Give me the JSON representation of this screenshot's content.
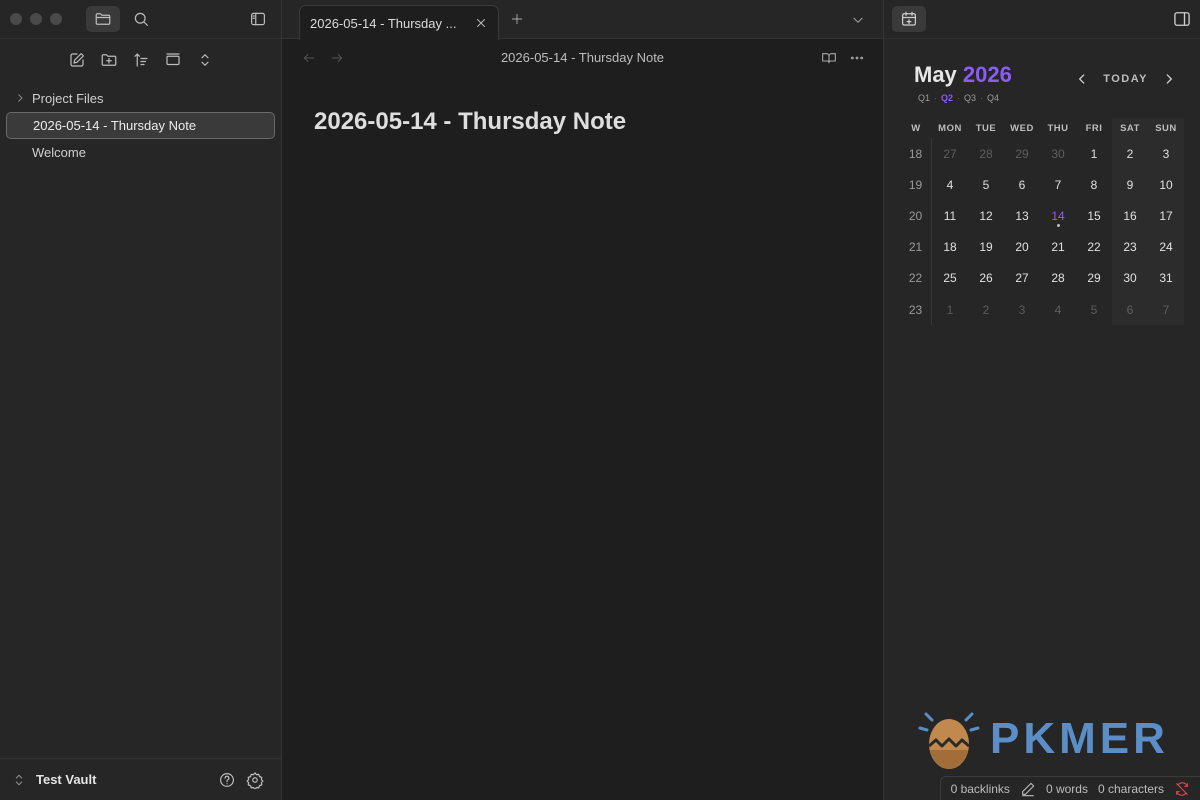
{
  "sidebar": {
    "tree": [
      {
        "label": "Project Files",
        "type": "folder"
      },
      {
        "label": "2026-05-14 - Thursday Note",
        "type": "file",
        "selected": true
      },
      {
        "label": "Welcome",
        "type": "file"
      }
    ],
    "vault_name": "Test Vault",
    "icons": [
      "folder-icon",
      "search-icon",
      "sidebar-toggle-icon",
      "new-note-icon",
      "new-folder-icon",
      "sort-icon",
      "collapse-icon",
      "expand-icon",
      "help-icon",
      "settings-icon"
    ]
  },
  "editor": {
    "tab_title": "2026-05-14 - Thursday ...",
    "view_title": "2026-05-14 - Thursday Note",
    "note_title": "2026-05-14 - Thursday Note"
  },
  "calendar": {
    "month": "May",
    "year": "2026",
    "quarters": [
      "Q1",
      "Q2",
      "Q3",
      "Q4"
    ],
    "active_quarter": "Q2",
    "today_label": "TODAY",
    "weekday_headers": [
      "W",
      "MON",
      "TUE",
      "WED",
      "THU",
      "FRI",
      "SAT",
      "SUN"
    ],
    "weeks": [
      {
        "week": "18",
        "days": [
          "27",
          "28",
          "29",
          "30",
          "1",
          "2",
          "3"
        ],
        "muted": [
          true,
          true,
          true,
          true,
          false,
          false,
          false
        ]
      },
      {
        "week": "19",
        "days": [
          "4",
          "5",
          "6",
          "7",
          "8",
          "9",
          "10"
        ],
        "muted": [
          false,
          false,
          false,
          false,
          false,
          false,
          false
        ]
      },
      {
        "week": "20",
        "days": [
          "11",
          "12",
          "13",
          "14",
          "15",
          "16",
          "17"
        ],
        "muted": [
          false,
          false,
          false,
          false,
          false,
          false,
          false
        ]
      },
      {
        "week": "21",
        "days": [
          "18",
          "19",
          "20",
          "21",
          "22",
          "23",
          "24"
        ],
        "muted": [
          false,
          false,
          false,
          false,
          false,
          false,
          false
        ]
      },
      {
        "week": "22",
        "days": [
          "25",
          "26",
          "27",
          "28",
          "29",
          "30",
          "31"
        ],
        "muted": [
          false,
          false,
          false,
          false,
          false,
          false,
          false
        ]
      },
      {
        "week": "23",
        "days": [
          "1",
          "2",
          "3",
          "4",
          "5",
          "6",
          "7"
        ],
        "muted": [
          true,
          true,
          true,
          true,
          true,
          true,
          true
        ]
      }
    ],
    "today_day": "14",
    "accent_color": "#8b5cf6"
  },
  "branding": {
    "logo_text": "PKMER"
  },
  "status": {
    "backlinks": "0 backlinks",
    "words": "0 words",
    "characters": "0 characters"
  }
}
